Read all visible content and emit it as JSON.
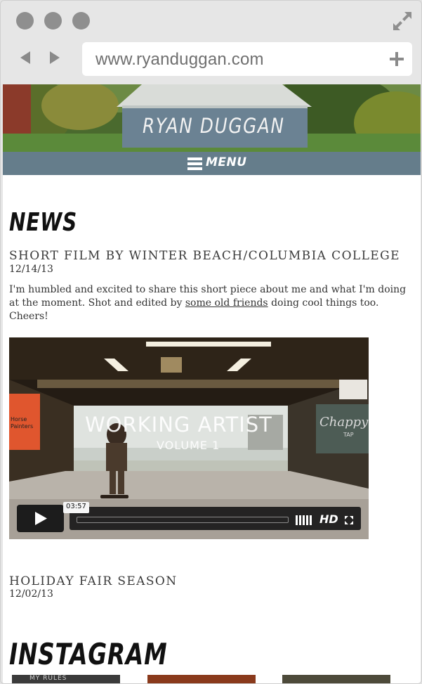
{
  "browser": {
    "url": "www.ryanduggan.com"
  },
  "site": {
    "banner_title": "RYAN DUGGAN",
    "menu_label": "MENU"
  },
  "news": {
    "heading": "NEWS",
    "posts": [
      {
        "title": "SHORT FILM BY WINTER BEACH/COLUMBIA COLLEGE",
        "date": "12/14/13",
        "body_before": "I'm humbled and excited to share this short piece about me and what I'm doing at the moment. Shot and edited by ",
        "link_text": "some old friends",
        "body_after": " doing cool things too. Cheers!"
      },
      {
        "title": "HOLIDAY FAIR SEASON",
        "date": "12/02/13"
      }
    ]
  },
  "video": {
    "title_line1": "WORKING ARTIST",
    "title_line2": "VOLUME 1",
    "left_sign": "Horse\nPainters",
    "right_sign": "Chappy's",
    "right_sign_sub": "TAP",
    "duration": "03:57",
    "hd_label": "HD",
    "progress": 0
  },
  "instagram": {
    "heading": "INSTAGRAM",
    "thumb1_text": "MY RULES"
  }
}
